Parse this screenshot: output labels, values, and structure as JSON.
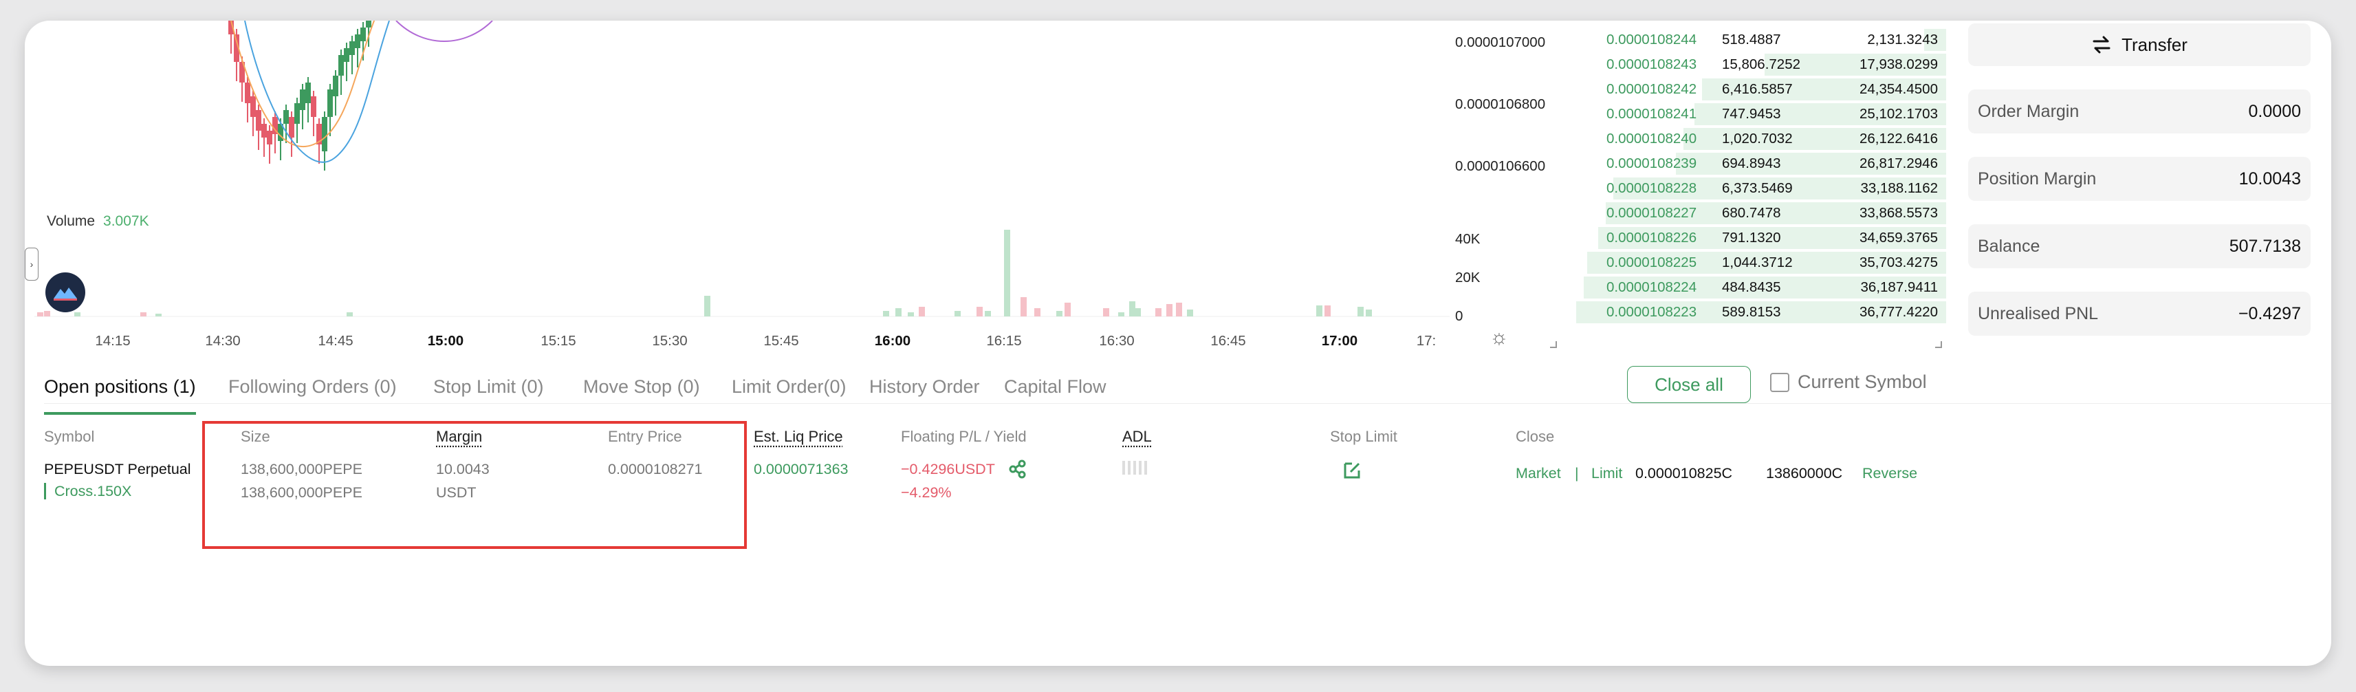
{
  "chart": {
    "price_axis": [
      "0.0000107000",
      "0.0000106800",
      "0.0000106600"
    ],
    "volume_label": "Volume",
    "volume_value": "3.007K",
    "volume_axis": [
      "40K",
      "20K",
      "0"
    ],
    "time_axis": [
      "14:15",
      "14:30",
      "14:45",
      "15:00",
      "15:15",
      "15:30",
      "15:45",
      "16:00",
      "16:15",
      "16:30",
      "16:45",
      "17:00",
      "17:"
    ],
    "up_color": "#3d9a5e",
    "down_color": "#e45b6a"
  },
  "orderbook": {
    "rows": [
      {
        "price": "0.0000108244",
        "size": "518.4887",
        "total": "2,131.3243",
        "depth": 0.06
      },
      {
        "price": "0.0000108243",
        "size": "15,806.7252",
        "total": "17,938.0299",
        "depth": 0.49
      },
      {
        "price": "0.0000108242",
        "size": "6,416.5857",
        "total": "24,354.4500",
        "depth": 0.66
      },
      {
        "price": "0.0000108241",
        "size": "747.9453",
        "total": "25,102.1703",
        "depth": 0.68
      },
      {
        "price": "0.0000108240",
        "size": "1,020.7032",
        "total": "26,122.6416",
        "depth": 0.71
      },
      {
        "price": "0.0000108239",
        "size": "694.8943",
        "total": "26,817.2946",
        "depth": 0.73
      },
      {
        "price": "0.0000108228",
        "size": "6,373.5469",
        "total": "33,188.1162",
        "depth": 0.9
      },
      {
        "price": "0.0000108227",
        "size": "680.7478",
        "total": "33,868.5573",
        "depth": 0.92
      },
      {
        "price": "0.0000108226",
        "size": "791.1320",
        "total": "34,659.3765",
        "depth": 0.94
      },
      {
        "price": "0.0000108225",
        "size": "1,044.3712",
        "total": "35,703.4275",
        "depth": 0.97
      },
      {
        "price": "0.0000108224",
        "size": "484.8435",
        "total": "36,187.9411",
        "depth": 0.98
      },
      {
        "price": "0.0000108223",
        "size": "589.8153",
        "total": "36,777.4220",
        "depth": 1.0
      }
    ]
  },
  "panel": {
    "transfer_label": "Transfer",
    "order_margin_label": "Order Margin",
    "order_margin_value": "0.0000",
    "position_margin_label": "Position Margin",
    "position_margin_value": "10.0043",
    "balance_label": "Balance",
    "balance_value": "507.7138",
    "upnl_label": "Unrealised PNL",
    "upnl_value": "−0.4297"
  },
  "tabs": [
    "Open positions (1)",
    "Following Orders (0)",
    "Stop Limit (0)",
    "Move Stop (0)",
    "Limit Order(0)",
    "History Order",
    "Capital Flow"
  ],
  "toolbar": {
    "close_all_label": "Close all",
    "current_symbol_label": "Current Symbol"
  },
  "table": {
    "headers": {
      "symbol": "Symbol",
      "size": "Size",
      "margin": "Margin",
      "entry_price": "Entry Price",
      "liq_price": "Est. Liq Price",
      "pnl": "Floating P/L / Yield",
      "adl": "ADL",
      "stop_limit": "Stop Limit",
      "close": "Close"
    },
    "row": {
      "symbol": "PEPEUSDT Perpetual",
      "leverage": "Cross.150X",
      "size_1": "138,600,000PEPE",
      "size_2": "138,600,000PEPE",
      "margin_value": "10.0043",
      "margin_currency": "USDT",
      "entry_price": "0.0000108271",
      "liq_price": "0.0000071363",
      "pnl": "−0.4296USDT",
      "yield": "−4.29%",
      "market_label": "Market",
      "separator": "|",
      "limit_label": "Limit",
      "close_price": "0.000010825C",
      "close_qty": "13860000C",
      "reverse_label": "Reverse"
    }
  }
}
